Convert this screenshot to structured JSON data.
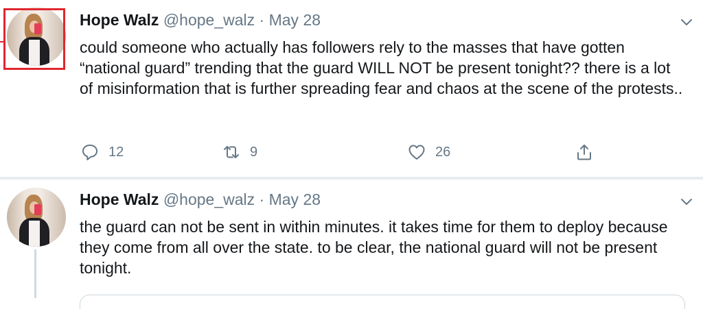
{
  "tweets": [
    {
      "author_name": "Hope Walz",
      "author_handle": "@hope_walz",
      "separator": "·",
      "date": "May 28",
      "text": "could someone who actually has followers rely to the masses that have gotten “national guard” trending that the guard WILL NOT be present tonight?? there is a lot of misinformation that is further spreading fear and chaos at the scene of the protests..",
      "reply_count": "12",
      "retweet_count": "9",
      "like_count": "26"
    },
    {
      "author_name": "Hope Walz",
      "author_handle": "@hope_walz",
      "separator": "·",
      "date": "May 28",
      "text": "the guard can not be sent in within minutes. it takes time for them to deploy because they come from all over the state. to be clear, the national guard will not be present tonight."
    }
  ],
  "colors": {
    "highlight": "#e0262e",
    "secondary_text": "#657786",
    "primary_text": "#14171a",
    "divider": "#e6ecf0"
  },
  "icons": [
    "chevron-down-icon",
    "reply-icon",
    "retweet-icon",
    "like-icon",
    "share-icon"
  ]
}
